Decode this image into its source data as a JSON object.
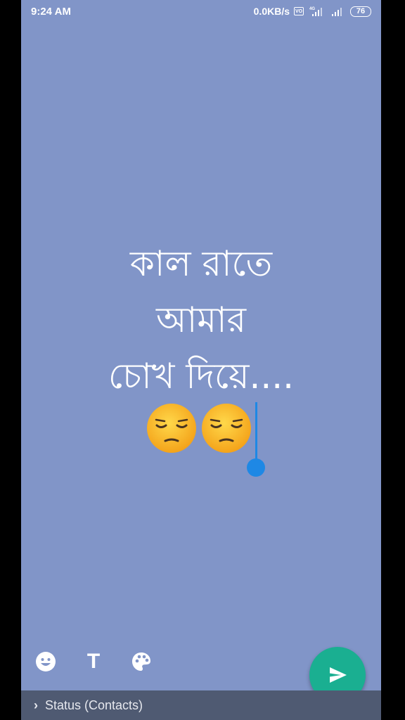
{
  "statusbar": {
    "time": "9:24 AM",
    "net_speed": "0.0KB/s",
    "net_type": "4G",
    "battery": "76"
  },
  "status_text": {
    "lines": [
      "কাল রাতে",
      "আমার",
      "চোখ দিয়ে...."
    ],
    "emojis": [
      "pensive-face",
      "pensive-face"
    ]
  },
  "background_color": "#8195c8",
  "toolbar": {
    "emoji_icon": "emoji-icon",
    "text_icon": "T",
    "palette_icon": "palette-icon"
  },
  "send_button": {
    "icon": "send-icon",
    "color": "#1aaf91"
  },
  "footer": {
    "audience": "Status (Contacts)"
  }
}
